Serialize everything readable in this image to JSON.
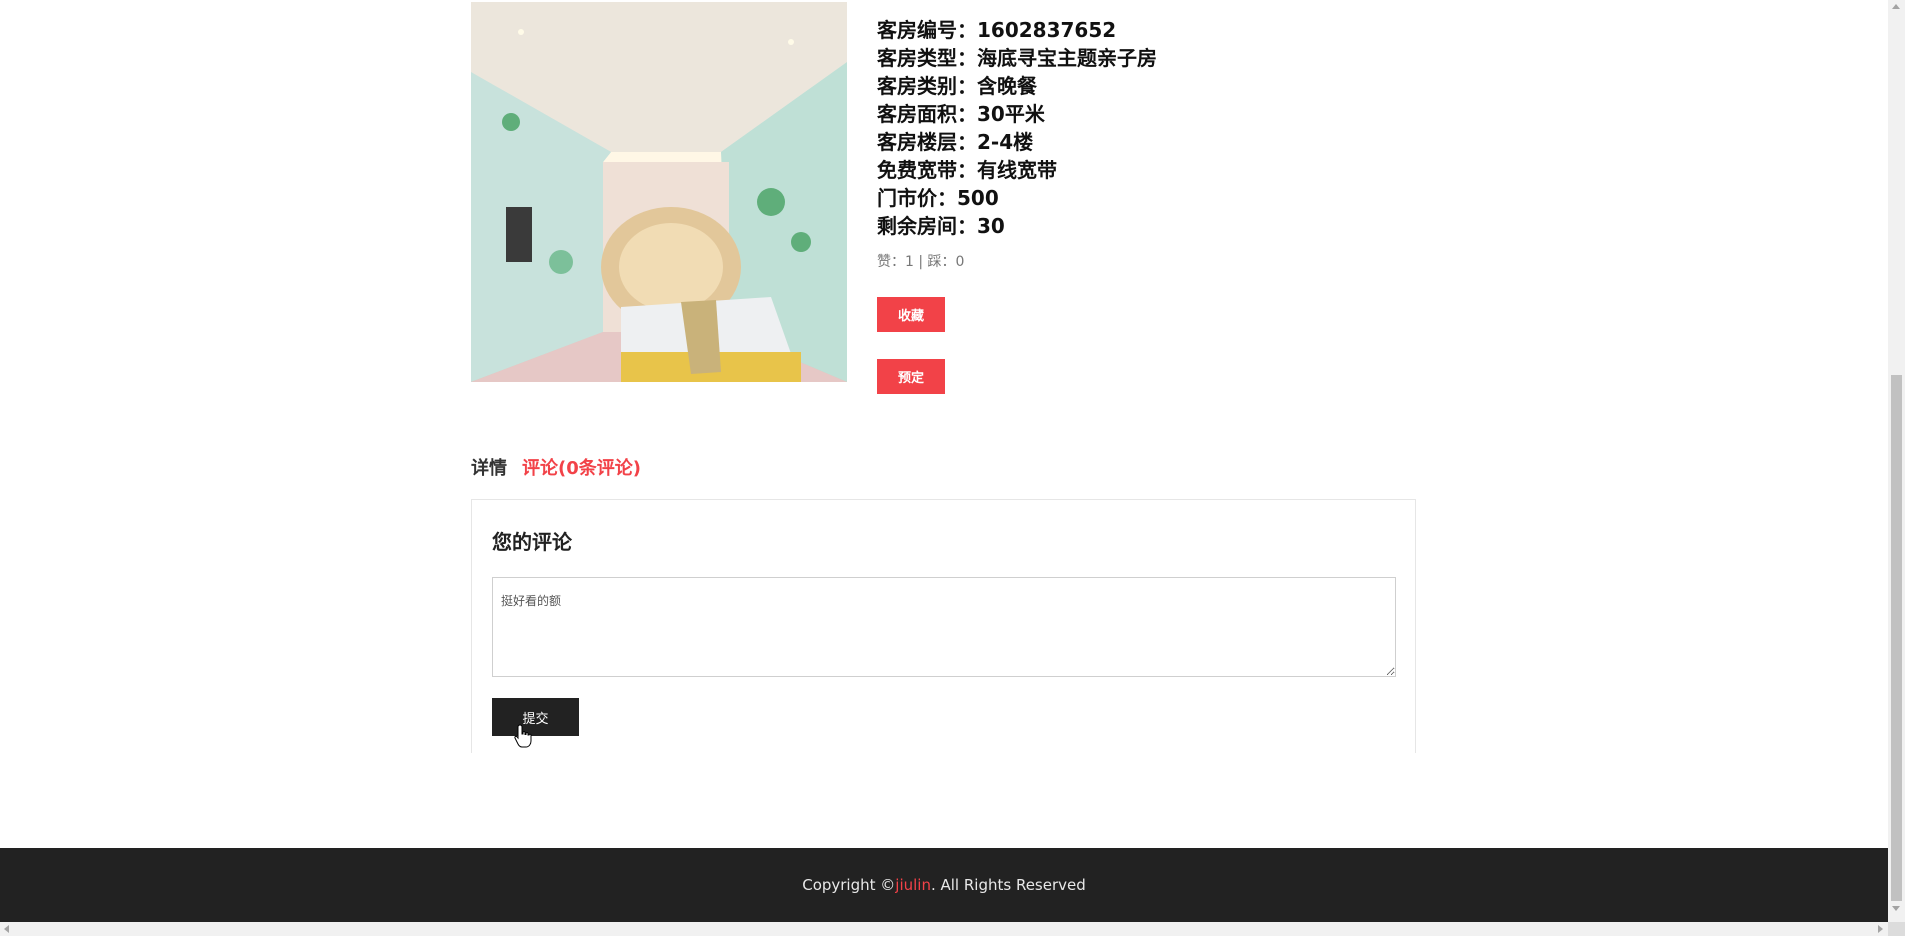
{
  "room": {
    "photo_alt": "room photo",
    "details": [
      {
        "label": "客房编号：",
        "value": "1602837652"
      },
      {
        "label": "客房类型：",
        "value": "海底寻宝主题亲子房"
      },
      {
        "label": "客房类别：",
        "value": "含晚餐"
      },
      {
        "label": "客房面积：",
        "value": "30平米"
      },
      {
        "label": "客房楼层：",
        "value": "2-4楼"
      },
      {
        "label": "免费宽带：",
        "value": "有线宽带"
      },
      {
        "label": "门市价：",
        "value": "500"
      },
      {
        "label": "剩余房间：",
        "value": "30"
      }
    ],
    "votes": "赞：1 | 踩：0"
  },
  "actions": {
    "favorite_label": "收藏",
    "book_label": "预定"
  },
  "tabs": {
    "detail_label": "详情",
    "comments_label": "评论(0条评论)"
  },
  "review": {
    "title": "您的评论",
    "input_value": "挺好看的额",
    "submit_label": "提交"
  },
  "footer": {
    "prefix": "Copyright © ",
    "brand": "jiulin",
    "suffix": ". All Rights Reserved"
  },
  "colors": {
    "accent": "#f24248",
    "footer_bg": "#222222",
    "submit_bg": "#222222"
  }
}
